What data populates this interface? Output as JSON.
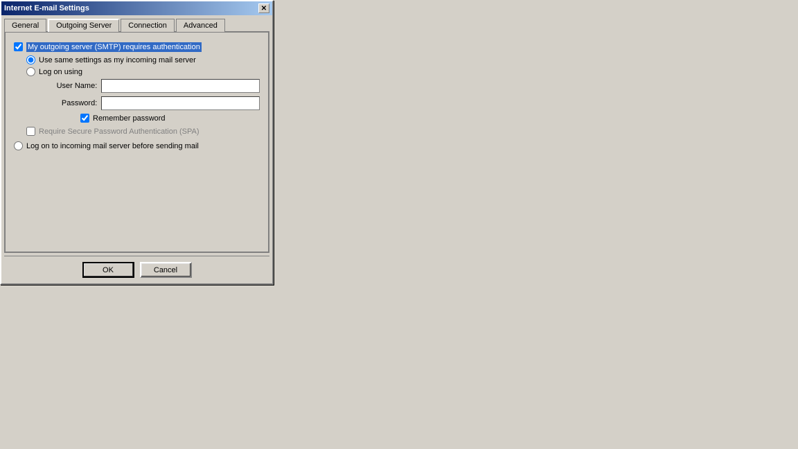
{
  "window": {
    "title": "Internet E-mail Settings",
    "close_button": "✕"
  },
  "tabs": [
    {
      "id": "general",
      "label": "General"
    },
    {
      "id": "outgoing-server",
      "label": "Outgoing Server",
      "active": true
    },
    {
      "id": "connection",
      "label": "Connection"
    },
    {
      "id": "advanced",
      "label": "Advanced"
    }
  ],
  "outgoing_server": {
    "smtp_auth_checkbox_label": "My outgoing server (SMTP) requires authentication",
    "smtp_auth_checked": true,
    "use_same_settings_label": "Use same settings as my incoming mail server",
    "use_same_settings_checked": true,
    "log_on_using_label": "Log on using",
    "log_on_using_checked": false,
    "user_name_label": "User Name:",
    "user_name_value": "",
    "password_label": "Password:",
    "password_value": "",
    "remember_password_label": "Remember password",
    "remember_password_checked": true,
    "spa_label": "Require Secure Password Authentication (SPA)",
    "spa_checked": false,
    "logon_incoming_label": "Log on to incoming mail server before sending mail",
    "logon_incoming_checked": false
  },
  "buttons": {
    "ok_label": "OK",
    "cancel_label": "Cancel"
  }
}
